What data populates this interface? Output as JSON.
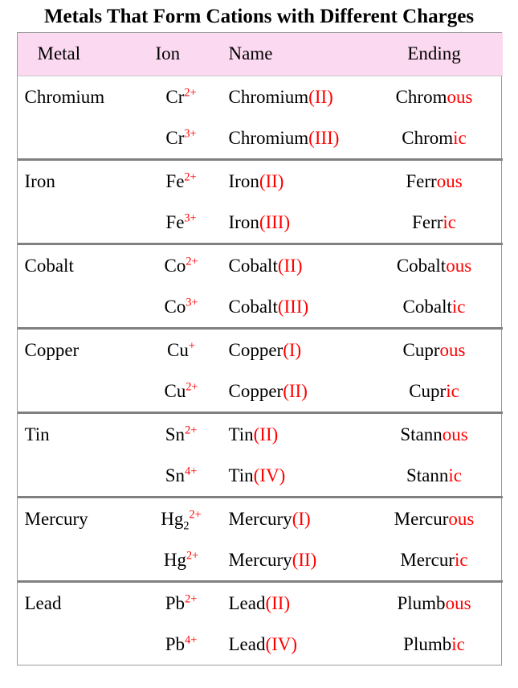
{
  "title": "Metals That Form Cations with Different Charges",
  "colors": {
    "header_background": "#FBD9F0",
    "accent_red": "#FF0000",
    "divider_gray": "#808080",
    "border_gray": "#9a9a9a",
    "text_black": "#000000"
  },
  "table": {
    "columns": [
      "Metal",
      "Ion",
      "Name",
      "Ending"
    ],
    "rows": [
      {
        "metal": "Chromium",
        "entries": [
          {
            "ion": {
              "symbol": "Cr",
              "subscript": "",
              "charge": "2+"
            },
            "name": {
              "base": "Chromium",
              "numeral": "(II)"
            },
            "ending": {
              "stem": "Chrom",
              "suffix": "ous"
            }
          },
          {
            "ion": {
              "symbol": "Cr",
              "subscript": "",
              "charge": "3+"
            },
            "name": {
              "base": "Chromium",
              "numeral": "(III)"
            },
            "ending": {
              "stem": "Chrom",
              "suffix": "ic"
            }
          }
        ]
      },
      {
        "metal": "Iron",
        "entries": [
          {
            "ion": {
              "symbol": "Fe",
              "subscript": "",
              "charge": "2+"
            },
            "name": {
              "base": "Iron",
              "numeral": "(II)"
            },
            "ending": {
              "stem": "Ferr",
              "suffix": "ous"
            }
          },
          {
            "ion": {
              "symbol": "Fe",
              "subscript": "",
              "charge": "3+"
            },
            "name": {
              "base": "Iron",
              "numeral": "(III)"
            },
            "ending": {
              "stem": "Ferr",
              "suffix": "ic"
            }
          }
        ]
      },
      {
        "metal": "Cobalt",
        "entries": [
          {
            "ion": {
              "symbol": "Co",
              "subscript": "",
              "charge": "2+"
            },
            "name": {
              "base": "Cobalt",
              "numeral": "(II)"
            },
            "ending": {
              "stem": "Cobalt",
              "suffix": "ous"
            }
          },
          {
            "ion": {
              "symbol": "Co",
              "subscript": "",
              "charge": "3+"
            },
            "name": {
              "base": "Cobalt",
              "numeral": "(III)"
            },
            "ending": {
              "stem": "Cobalt",
              "suffix": "ic"
            }
          }
        ]
      },
      {
        "metal": "Copper",
        "entries": [
          {
            "ion": {
              "symbol": "Cu",
              "subscript": "",
              "charge": "+"
            },
            "name": {
              "base": "Copper",
              "numeral": "(I)"
            },
            "ending": {
              "stem": "Cupr",
              "suffix": "ous"
            }
          },
          {
            "ion": {
              "symbol": "Cu",
              "subscript": "",
              "charge": "2+"
            },
            "name": {
              "base": "Copper",
              "numeral": "(II)"
            },
            "ending": {
              "stem": "Cupr",
              "suffix": "ic"
            }
          }
        ]
      },
      {
        "metal": "Tin",
        "entries": [
          {
            "ion": {
              "symbol": "Sn",
              "subscript": "",
              "charge": "2+"
            },
            "name": {
              "base": "Tin",
              "numeral": "(II)"
            },
            "ending": {
              "stem": "Stann",
              "suffix": "ous"
            }
          },
          {
            "ion": {
              "symbol": "Sn",
              "subscript": "",
              "charge": "4+"
            },
            "name": {
              "base": "Tin",
              "numeral": "(IV)"
            },
            "ending": {
              "stem": "Stann",
              "suffix": "ic"
            }
          }
        ]
      },
      {
        "metal": "Mercury",
        "entries": [
          {
            "ion": {
              "symbol": "Hg",
              "subscript": "2",
              "charge": "2+"
            },
            "name": {
              "base": "Mercury",
              "numeral": "(I)"
            },
            "ending": {
              "stem": "Mercur",
              "suffix": "ous"
            }
          },
          {
            "ion": {
              "symbol": "Hg",
              "subscript": "",
              "charge": "2+"
            },
            "name": {
              "base": "Mercury",
              "numeral": "(II)"
            },
            "ending": {
              "stem": "Mercur",
              "suffix": "ic"
            }
          }
        ]
      },
      {
        "metal": "Lead",
        "entries": [
          {
            "ion": {
              "symbol": "Pb",
              "subscript": "",
              "charge": "2+"
            },
            "name": {
              "base": "Lead",
              "numeral": "(II)"
            },
            "ending": {
              "stem": "Plumb",
              "suffix": "ous"
            }
          },
          {
            "ion": {
              "symbol": "Pb",
              "subscript": "",
              "charge": "4+"
            },
            "name": {
              "base": "Lead",
              "numeral": "(IV)"
            },
            "ending": {
              "stem": "Plumb",
              "suffix": "ic"
            }
          }
        ]
      }
    ]
  }
}
